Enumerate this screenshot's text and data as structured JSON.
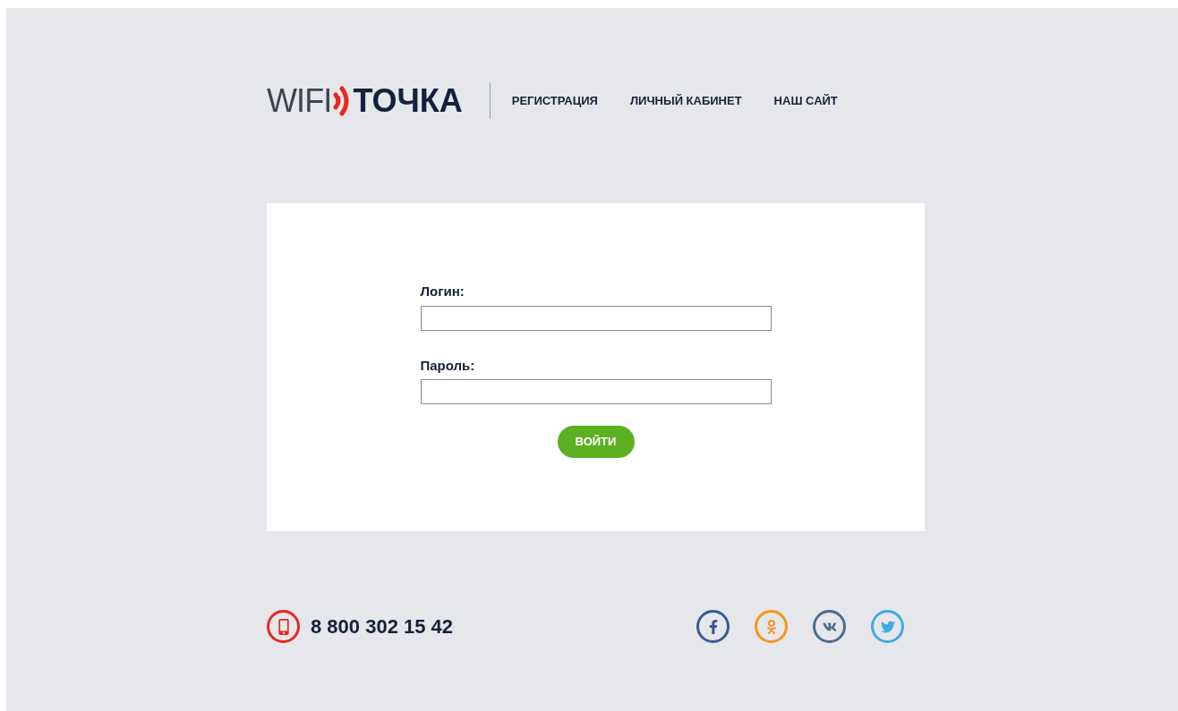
{
  "logo": {
    "left": "WIFI",
    "right": "ТОЧКА"
  },
  "nav": [
    "РЕГИСТРАЦИЯ",
    "ЛИЧНЫЙ КАБИНЕТ",
    "НАШ САЙТ"
  ],
  "form": {
    "fields": [
      {
        "label": "Логин:"
      },
      {
        "label": "Пароль:"
      }
    ],
    "submit": "ВОЙТИ"
  },
  "footer": {
    "phone": "8 800 302 15 42",
    "social": [
      {
        "kind": "facebook",
        "color": "#3b5998"
      },
      {
        "kind": "odnoklassniki",
        "color": "#f7931e"
      },
      {
        "kind": "vk",
        "color": "#4c6c91"
      },
      {
        "kind": "twitter",
        "color": "#41abe1"
      }
    ]
  }
}
